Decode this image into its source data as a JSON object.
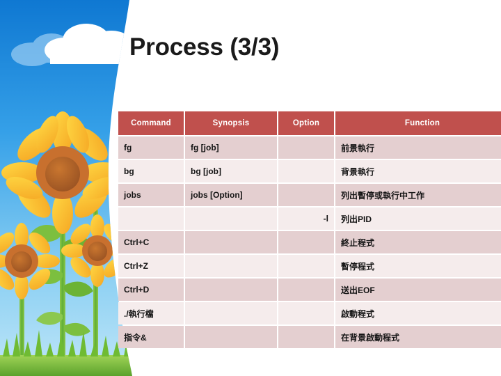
{
  "slide": {
    "title": "Process (3/3)"
  },
  "table": {
    "headers": {
      "command": "Command",
      "synopsis": "Synopsis",
      "option": "Option",
      "function": "Function"
    },
    "rows": [
      {
        "command": "fg",
        "synopsis": "fg [job]",
        "option": "",
        "function": "前景執行"
      },
      {
        "command": "bg",
        "synopsis": "bg [job]",
        "option": "",
        "function": "背景執行"
      },
      {
        "command": "jobs",
        "synopsis": "jobs [Option]",
        "option": "",
        "function": "列出暫停或執行中工作"
      },
      {
        "command": "",
        "synopsis": "",
        "option": "-l",
        "function": "列出PID"
      },
      {
        "command": "Ctrl+C",
        "synopsis": "",
        "option": "",
        "function": "終止程式"
      },
      {
        "command": "Ctrl+Z",
        "synopsis": "",
        "option": "",
        "function": "暫停程式"
      },
      {
        "command": "Ctrl+D",
        "synopsis": "",
        "option": "",
        "function": "送出EOF"
      },
      {
        "command": "./執行檔",
        "synopsis": "",
        "option": "",
        "function": "啟動程式"
      },
      {
        "command": "指令&",
        "synopsis": "",
        "option": "",
        "function": "在背景啟動程式"
      }
    ]
  },
  "decoration": {
    "sky_top_color": "#1a7fd4",
    "sky_bottom_color": "#a8dcf5",
    "cloud_color": "#ffffff",
    "cloud_shadow_color": "#9fd0f5",
    "petal_color": "#ffcc22",
    "petal_dark_color": "#f0a81e",
    "center_outer_color": "#c8702e",
    "center_inner_color": "#8d4f22",
    "stem_color": "#6cb33f",
    "leaf_color": "#8cc63f",
    "grass_color": "#7ac142",
    "header_accent_color": "#c0504d",
    "row_odd_color": "#e4cfd0",
    "row_even_color": "#f5ecec"
  }
}
